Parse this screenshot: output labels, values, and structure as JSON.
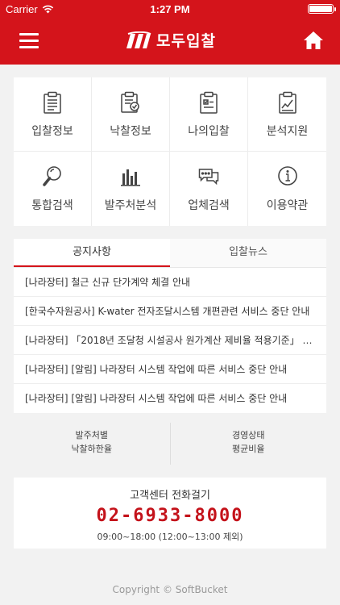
{
  "status_bar": {
    "carrier": "Carrier",
    "time": "1:27 PM",
    "battery_level": 1.0
  },
  "header": {
    "logo_text": "모두입찰",
    "brand_color": "#d4141b"
  },
  "menu_grid": [
    {
      "label": "입찰정보",
      "icon": "clipboard-list-icon"
    },
    {
      "label": "낙찰정보",
      "icon": "clipboard-award-icon"
    },
    {
      "label": "나의입찰",
      "icon": "clipboard-check-icon"
    },
    {
      "label": "분석지원",
      "icon": "clipboard-chart-icon"
    },
    {
      "label": "통합검색",
      "icon": "magnifier-icon"
    },
    {
      "label": "발주처분석",
      "icon": "bar-chart-icon"
    },
    {
      "label": "업체검색",
      "icon": "chat-bubbles-icon"
    },
    {
      "label": "이용약관",
      "icon": "info-circle-icon"
    }
  ],
  "notice_tabs": {
    "active": "공지사항",
    "inactive": "입찰뉴스"
  },
  "notices": [
    "[나라장터] 철근 신규 단가계약 체결 안내",
    "[한국수자원공사] K-water 전자조달시스템 개편관련 서비스 중단 안내",
    "[나라장터] 「2018년 조달청 시설공사 원가계산 제비율 적용기준」 …",
    "[나라장터] [알림] 나라장터 시스템 작업에 따른 서비스 중단 안내",
    "[나라장터] [알림] 나라장터 시스템 작업에 따른 서비스 중단 안내"
  ],
  "stats": [
    {
      "line1": "발주처별",
      "line2": "낙찰하한율"
    },
    {
      "line1": "경영상태",
      "line2": "평균비율"
    }
  ],
  "call_center": {
    "title": "고객센터 전화걸기",
    "phone": "02-6933-8000",
    "hours": "09:00~18:00 (12:00~13:00 제외)",
    "phone_color": "#c4121a"
  },
  "footer": {
    "copyright": "Copyright © SoftBucket"
  }
}
